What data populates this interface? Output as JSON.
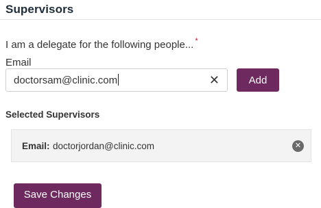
{
  "section": {
    "title": "Supervisors"
  },
  "delegate": {
    "text": "I am a delegate for the following people...",
    "required_marker": "*"
  },
  "email": {
    "label": "Email",
    "value": "doctorsam@clinic.com",
    "clear_icon": "close-icon"
  },
  "add_button": {
    "label": "Add"
  },
  "selected": {
    "title": "Selected Supervisors",
    "items": [
      {
        "label": "Email:",
        "value": "doctorjordan@clinic.com",
        "remove_icon": "remove-circle-icon"
      }
    ]
  },
  "save_button": {
    "label": "Save Changes"
  },
  "colors": {
    "accent": "#6e2a5f",
    "required": "#c8102e",
    "card_bg": "#f3f3f3"
  }
}
